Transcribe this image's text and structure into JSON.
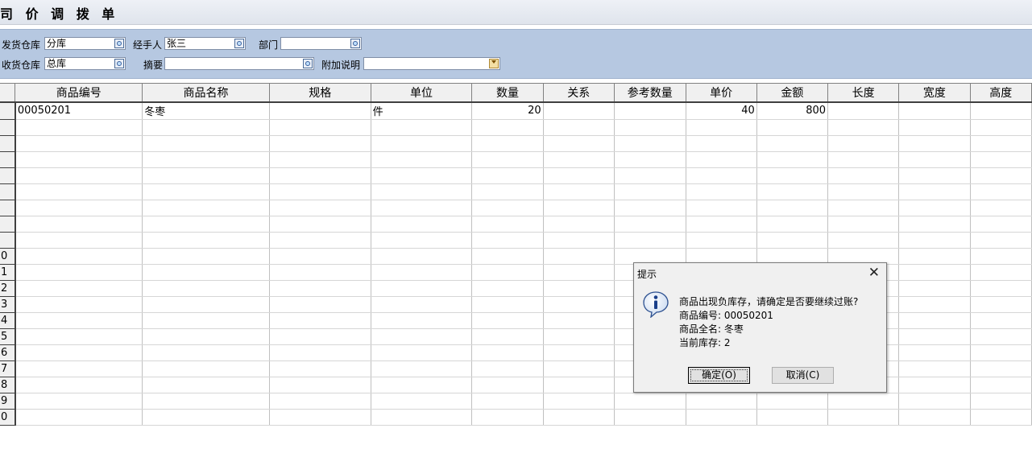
{
  "window": {
    "title": "司 价 调 拨 单"
  },
  "form": {
    "ship_warehouse": {
      "label": "发货仓库",
      "value": "分库"
    },
    "handler": {
      "label": "经手人",
      "value": "张三"
    },
    "department": {
      "label": "部门",
      "value": ""
    },
    "recv_warehouse": {
      "label": "收货仓库",
      "value": "总库"
    },
    "summary": {
      "label": "摘要",
      "value": ""
    },
    "note": {
      "label": "附加说明",
      "value": ""
    }
  },
  "grid": {
    "columns": [
      "商品编号",
      "商品名称",
      "规格",
      "单位",
      "数量",
      "关系",
      "参考数量",
      "单价",
      "金额",
      "长度",
      "宽度",
      "高度"
    ],
    "rows": [
      [
        "00050201",
        "冬枣",
        "",
        "件",
        "20",
        "",
        "",
        "40",
        "800",
        "",
        "",
        ""
      ]
    ],
    "row_numbers": [
      "",
      "",
      "",
      "",
      "",
      "",
      "",
      "",
      "",
      "0",
      "1",
      "2",
      "3",
      "4",
      "5",
      "6",
      "7",
      "8",
      "9",
      "0"
    ]
  },
  "dialog": {
    "title": "提示",
    "close_glyph": "✕",
    "icon": "info-icon",
    "message": "商品出现负库存，请确定是否要继续过账?",
    "code_line": "商品编号: 00050201",
    "name_line": "商品全名: 冬枣",
    "stock_line": "当前库存: 2",
    "ok_label": "确定(O)",
    "cancel_label": "取消(C)"
  },
  "colors": {
    "form_bg": "#b6c8e1",
    "dialog_bg": "#f0f0f0",
    "header_bg": "#f0f0f0"
  }
}
